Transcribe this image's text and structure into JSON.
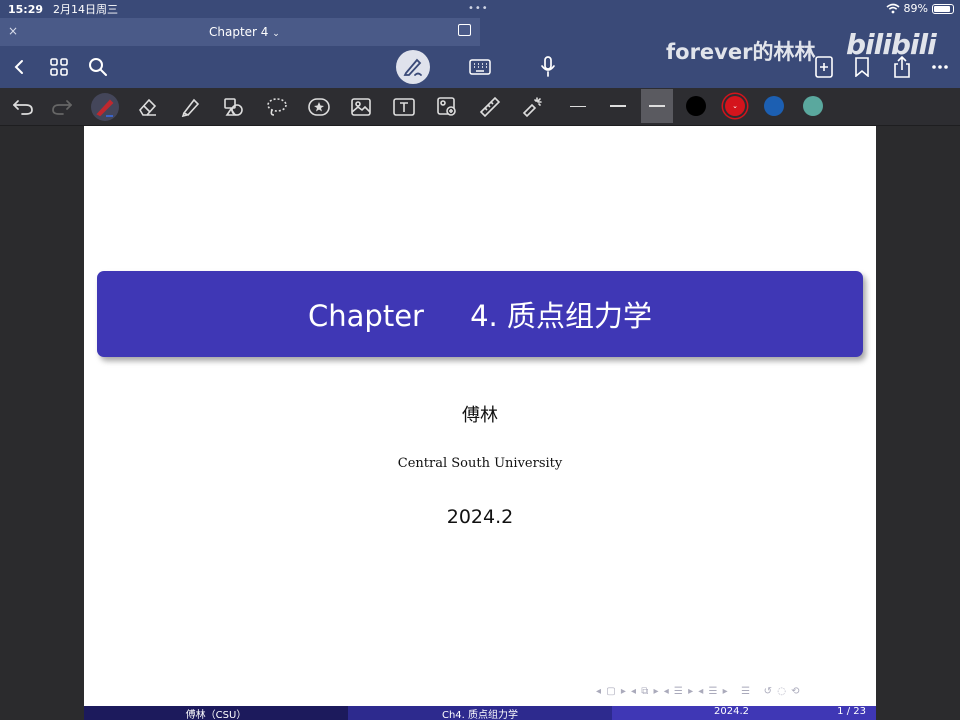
{
  "status": {
    "time": "15:29",
    "date": "2月14日周三",
    "dots": "•••",
    "battery": "89%",
    "battery_level": 0.89
  },
  "tab": {
    "title": "Chapter 4",
    "close": "×"
  },
  "watermark": {
    "text": "forever的林林",
    "logo": "bilibili"
  },
  "colors": {
    "bar": "#3a4a78",
    "title_box": "#3f37b5",
    "color_black": "#000000",
    "color_red": "#d4141c",
    "color_blue": "#1c5fb2",
    "color_teal": "#5aa89e"
  },
  "icons": {
    "nav": [
      "back-icon",
      "grid-icon",
      "search-icon",
      "pen-mode-icon",
      "keyboard-icon",
      "microphone-icon",
      "add-page-icon",
      "bookmark-icon",
      "share-icon",
      "more-icon"
    ],
    "tools": [
      "undo-icon",
      "redo-icon",
      "pen-icon",
      "eraser-icon",
      "highlighter-icon",
      "shapes-icon",
      "lasso-icon",
      "sticker-icon",
      "image-icon",
      "textbox-icon",
      "camera-icon",
      "ruler-icon",
      "laser-pointer-icon"
    ]
  },
  "slide": {
    "title": "Chapter     4. 质点组力学",
    "author": "傅林",
    "institution": "Central South University",
    "date": "2024.2"
  },
  "footer": {
    "author": "傅林（CSU）",
    "title": "Ch4. 质点组力学",
    "date": "2024.2",
    "page": "1 / 23"
  }
}
